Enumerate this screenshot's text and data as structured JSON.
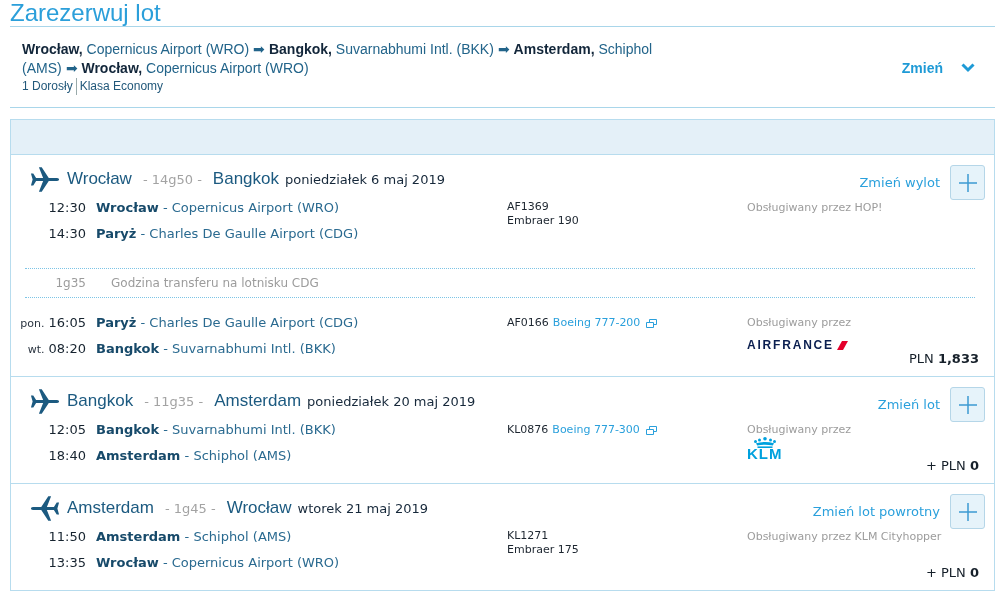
{
  "page": {
    "title": "Zarezerwuj lot"
  },
  "summary": {
    "route": "**Wrocław,** Copernicus Airport (WRO) ➡ **Bangkok,** Suvarnabhumi Intl. (BKK) ➡ **Amsterdam,** Schiphol (AMS) ➡ **Wrocław,** Copernicus Airport (WRO)",
    "passengers": "1 Dorosły",
    "cabin": "Klasa Economy",
    "change_label": "Zmień",
    "expanded": false
  },
  "segments": [
    {
      "kind": "outbound",
      "from": "Wrocław",
      "duration": "- 14g50 -",
      "to": "Bangkok",
      "date": "poniedziałek 6 maj 2019",
      "change_label": "Zmień wylot",
      "expanded": false,
      "legs": [
        {
          "kind": "flight",
          "departure": {
            "time": "12:30",
            "place": "**Wrocław** - Copernicus Airport (WRO)"
          },
          "arrival": {
            "time": "14:30",
            "place": "**Paryż** - Charles De Gaulle Airport (CDG)"
          },
          "flight_number": "AF1369",
          "aircraft": "Embraer 190",
          "aircraft_link": false,
          "operator": "Obsługiwany przez HOP!"
        },
        {
          "kind": "transfer",
          "duration": "1g35",
          "text": "Godzina transferu na lotnisku CDG"
        },
        {
          "kind": "flight",
          "departure": {
            "day": "pon.",
            "time": "16:05",
            "place": "**Paryż** - Charles De Gaulle Airport (CDG)"
          },
          "arrival": {
            "day": "wt.",
            "time": "08:20",
            "place": "**Bangkok** - Suvarnabhumi Intl. (BKK)"
          },
          "flight_number": "AF0166",
          "aircraft": "Boeing 777-200",
          "aircraft_link": true,
          "operator": "Obsługiwany przez",
          "logo": {
            "kind": "airfrance",
            "text": "AIRFRANCE"
          }
        }
      ],
      "price": "PLN **1,833**"
    },
    {
      "kind": "outbound",
      "from": "Bangkok",
      "duration": "- 11g35 -",
      "to": "Amsterdam",
      "date": "poniedziałek 20 maj 2019",
      "change_label": "Zmień lot",
      "expanded": false,
      "legs": [
        {
          "kind": "flight",
          "departure": {
            "time": "12:05",
            "place": "**Bangkok** - Suvarnabhumi Intl. (BKK)"
          },
          "arrival": {
            "time": "18:40",
            "place": "**Amsterdam** - Schiphol (AMS)"
          },
          "flight_number": "KL0876",
          "aircraft": "Boeing 777-300",
          "aircraft_link": true,
          "operator": "Obsługiwany przez",
          "logo": {
            "kind": "klm",
            "text": "KLM"
          }
        }
      ],
      "price": "+ PLN **0**"
    },
    {
      "kind": "return",
      "from": "Amsterdam",
      "duration": "- 1g45 -",
      "to": "Wrocław",
      "date": "wtorek 21 maj 2019",
      "change_label": "Zmień lot powrotny",
      "expanded": false,
      "legs": [
        {
          "kind": "flight",
          "departure": {
            "time": "11:50",
            "place": "**Amsterdam** - Schiphol (AMS)"
          },
          "arrival": {
            "time": "13:35",
            "place": "**Wrocław** - Copernicus Airport (WRO)"
          },
          "flight_number": "KL1271",
          "aircraft": "Embraer 175",
          "aircraft_link": false,
          "operator": "Obsługiwany przez KLM Cityhopper"
        }
      ],
      "price": "+ PLN **0**"
    }
  ]
}
